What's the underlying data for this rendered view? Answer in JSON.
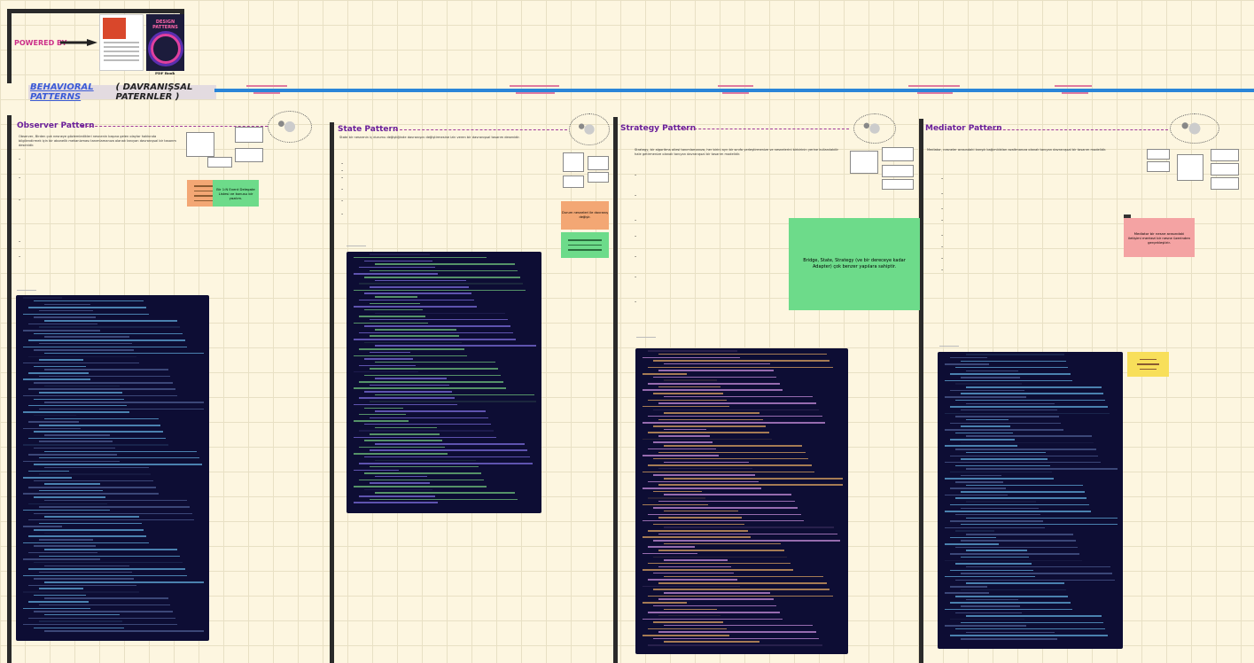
{
  "header": {
    "powered_by": "POWERED BY",
    "book_title_line1": "DESIGN",
    "book_title_line2": "PATTERNS",
    "pdf_label": "PDF Book",
    "title_main": "BEHAVIORAL PATTERNS",
    "title_sub": "( DAVRANIŞSAL PATERNLER )"
  },
  "sections": [
    {
      "id": "observer",
      "title": "Observer Pattern"
    },
    {
      "id": "state",
      "title": "State Pattern"
    },
    {
      "id": "strategy",
      "title": "Strategy Pattern"
    },
    {
      "id": "mediator",
      "title": "Mediator Pattern"
    }
  ],
  "observer": {
    "sticky_green": "Bir 1:N Event Delegate Listesi ve konusu bir yazılım.",
    "intro": "Observer, Birden çok nesneye gözlemledikleri nesnenin başına gelen olaylar hakkında bilgilendirmek için bir abonelik mekanizması tanımlamanıza olanak tanıyan davranışsal bir tasarım desenidir."
  },
  "state": {
    "sticky_orange": "Durum nesneleri ile davranış değişir.",
    "intro": "State bir nesnenin iç durumu değiştiğinde davranışını değiştirmesine izin veren bir davranışsal tasarım desenidir."
  },
  "strategy": {
    "sticky_green": "Bridge, State, Strategy (ve bir dereceye kadar Adapter) çok benzer yapılara sahiptir.",
    "intro": "Strategy, bir algoritma ailesi tanımlamanıza, her birini ayrı bir sınıfa yerleştirmenize ve nesnelerini birbirinin yerine kullanılabilir hale getirmenize olanak tanıyan davranışsal bir tasarım modelidir."
  },
  "mediator": {
    "sticky_pink": "Mediator bir nesne arasındaki iletişimi merkezi bir nesne üzerinden gerçekleştirir.",
    "intro": "Mediator, nesneler arasındaki karışık bağımlılıkları azaltmanıza olanak tanıyan davranışsal bir tasarım modelidir."
  }
}
